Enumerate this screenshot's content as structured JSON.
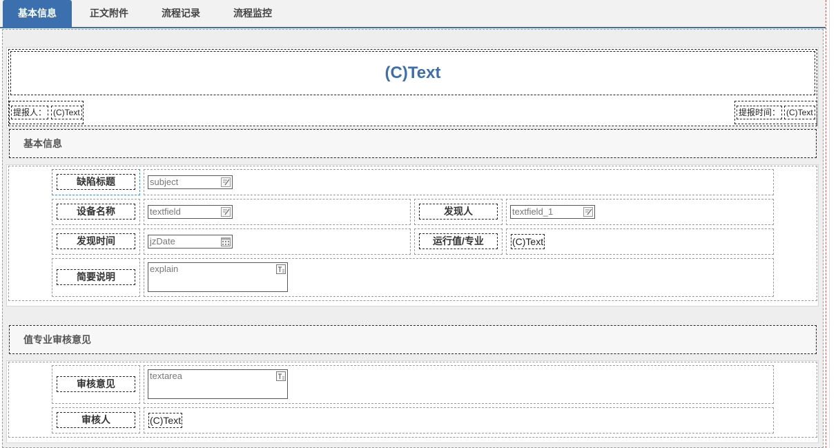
{
  "tabs": [
    {
      "label": "基本信息",
      "active": true
    },
    {
      "label": "正文附件",
      "active": false
    },
    {
      "label": "流程记录",
      "active": false
    },
    {
      "label": "流程监控",
      "active": false
    }
  ],
  "colors": {
    "accent": "#3c6fad",
    "section_bg": "#f7f7f7",
    "page_bg": "#eeeeee"
  },
  "header": {
    "title": "(C)Text",
    "reporter_label": "提报人：",
    "reporter_value": "(C)Text",
    "report_time_label": "提报时间：",
    "report_time_value": "(C)Text"
  },
  "basic_section": {
    "title": "基本信息",
    "defect_title_label": "缺陷标题",
    "defect_title_value": "subject",
    "device_name_label": "设备名称",
    "device_name_value": "textfield",
    "discoverer_label": "发现人",
    "discoverer_value": "textfield_1",
    "discover_time_label": "发现时间",
    "discover_time_value": "jzDate",
    "shift_label": "运行值/专业",
    "shift_value": "(C)Text",
    "summary_label": "简要说明",
    "summary_value": "explain"
  },
  "review_section": {
    "title": "值专业审核意见",
    "opinion_label": "审核意见",
    "opinion_value": "textarea",
    "reviewer_label": "审核人",
    "reviewer_value": "(C)Text"
  },
  "icons": {
    "text_field": "edit-icon",
    "date_field": "calendar-icon",
    "textarea": "textarea-icon"
  }
}
